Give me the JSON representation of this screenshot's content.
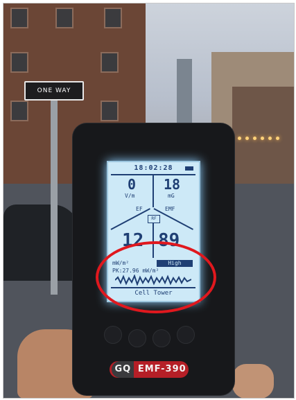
{
  "scene": {
    "street_sign_text": "ONE WAY",
    "meter": {
      "time": "18:02:28",
      "ef_value": "0",
      "ef_unit": "V/m",
      "emf_value": "18",
      "emf_unit": "mG",
      "ef_label": "EF",
      "emf_label": "EMF",
      "rf_label": "RF",
      "rf_value_1": "12",
      "rf_value_2": "89",
      "rf_unit": "mW/m²",
      "level": "High",
      "peak_text": "PK:27.96 mW/m²",
      "source_label": "Cell Tower",
      "brand_gq": "GQ",
      "brand_model": "EMF-390"
    }
  },
  "colors": {
    "highlight_circle": "#e0181e",
    "screen_background": "#cde9f7",
    "screen_text": "#1f3f74"
  }
}
